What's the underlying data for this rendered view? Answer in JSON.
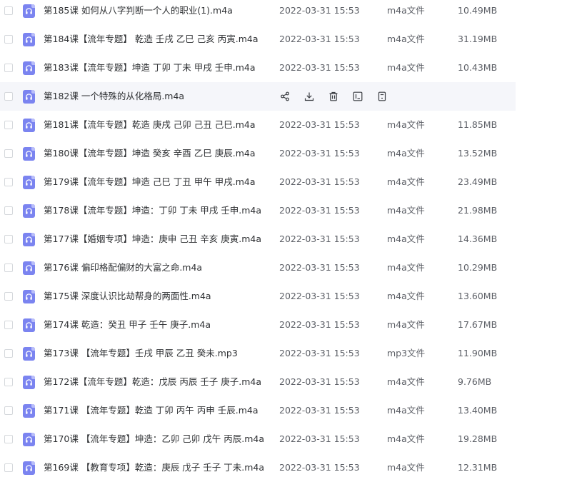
{
  "files": [
    {
      "name": "第185课  如何从八字判断一个人的职业(1).m4a",
      "date": "2022-03-31 15:53",
      "type": "m4a文件",
      "size": "10.49MB"
    },
    {
      "name": "第184课【流年专题】 乾造 壬戌 乙巳 己亥 丙寅.m4a",
      "date": "2022-03-31 15:53",
      "type": "m4a文件",
      "size": "31.19MB"
    },
    {
      "name": "第183课【流年专题】坤造 丁卯 丁未 甲戌 壬申.m4a",
      "date": "2022-03-31 15:53",
      "type": "m4a文件",
      "size": "10.43MB"
    },
    {
      "name": "第182课 一个特殊的从化格局.m4a",
      "date": "",
      "type": "",
      "size": "",
      "hovered": true
    },
    {
      "name": "第181课【流年专题】乾造 庚戌 己卯 己丑 己巳.m4a",
      "date": "2022-03-31 15:53",
      "type": "m4a文件",
      "size": "11.85MB"
    },
    {
      "name": "第180课【流年专题】坤造 癸亥 辛酉 乙巳 庚辰.m4a",
      "date": "2022-03-31 15:53",
      "type": "m4a文件",
      "size": "13.52MB"
    },
    {
      "name": "第179课【流年专题】坤造 己巳 丁丑 甲午 甲戌.m4a",
      "date": "2022-03-31 15:53",
      "type": "m4a文件",
      "size": "23.49MB"
    },
    {
      "name": "第178课【流年专题】坤造：丁卯 丁未 甲戌 壬申.m4a",
      "date": "2022-03-31 15:53",
      "type": "m4a文件",
      "size": "21.98MB"
    },
    {
      "name": "第177课【婚姻专项】坤造：庚申 己丑 辛亥 庚寅.m4a",
      "date": "2022-03-31 15:53",
      "type": "m4a文件",
      "size": "14.36MB"
    },
    {
      "name": "第176课 偏印格配偏财的大富之命.m4a",
      "date": "2022-03-31 15:53",
      "type": "m4a文件",
      "size": "10.29MB"
    },
    {
      "name": "第175课 深度认识比劫帮身的两面性.m4a",
      "date": "2022-03-31 15:53",
      "type": "m4a文件",
      "size": "13.60MB"
    },
    {
      "name": "第174课  乾造：癸丑 甲子 壬午 庚子.m4a",
      "date": "2022-03-31 15:53",
      "type": "m4a文件",
      "size": "17.67MB"
    },
    {
      "name": "第173课 【流年专题】壬戌 甲辰 乙丑 癸未.mp3",
      "date": "2022-03-31 15:53",
      "type": "mp3文件",
      "size": "11.90MB"
    },
    {
      "name": "第172课【流年专题】乾造：戊辰 丙辰 壬子 庚子.m4a",
      "date": "2022-03-31 15:53",
      "type": "m4a文件",
      "size": "9.76MB"
    },
    {
      "name": "第171课 【流年专题】乾造 丁卯 丙午 丙申 壬辰.m4a",
      "date": "2022-03-31 15:53",
      "type": "m4a文件",
      "size": "13.40MB"
    },
    {
      "name": "第170课 【流年专题】坤造：乙卯 己卯 戊午 丙辰.m4a",
      "date": "2022-03-31 15:53",
      "type": "m4a文件",
      "size": "19.28MB"
    },
    {
      "name": "第169课 【教育专项】乾造：庚辰 戊子 壬子 丁未.m4a",
      "date": "2022-03-31 15:53",
      "type": "m4a文件",
      "size": "12.31MB"
    }
  ],
  "row_actions": [
    "share-icon",
    "download-icon",
    "delete-icon",
    "rename-icon",
    "more-icon"
  ],
  "colors": {
    "file_icon": "#7b84f0",
    "hover_row": "#f5f6fa"
  }
}
